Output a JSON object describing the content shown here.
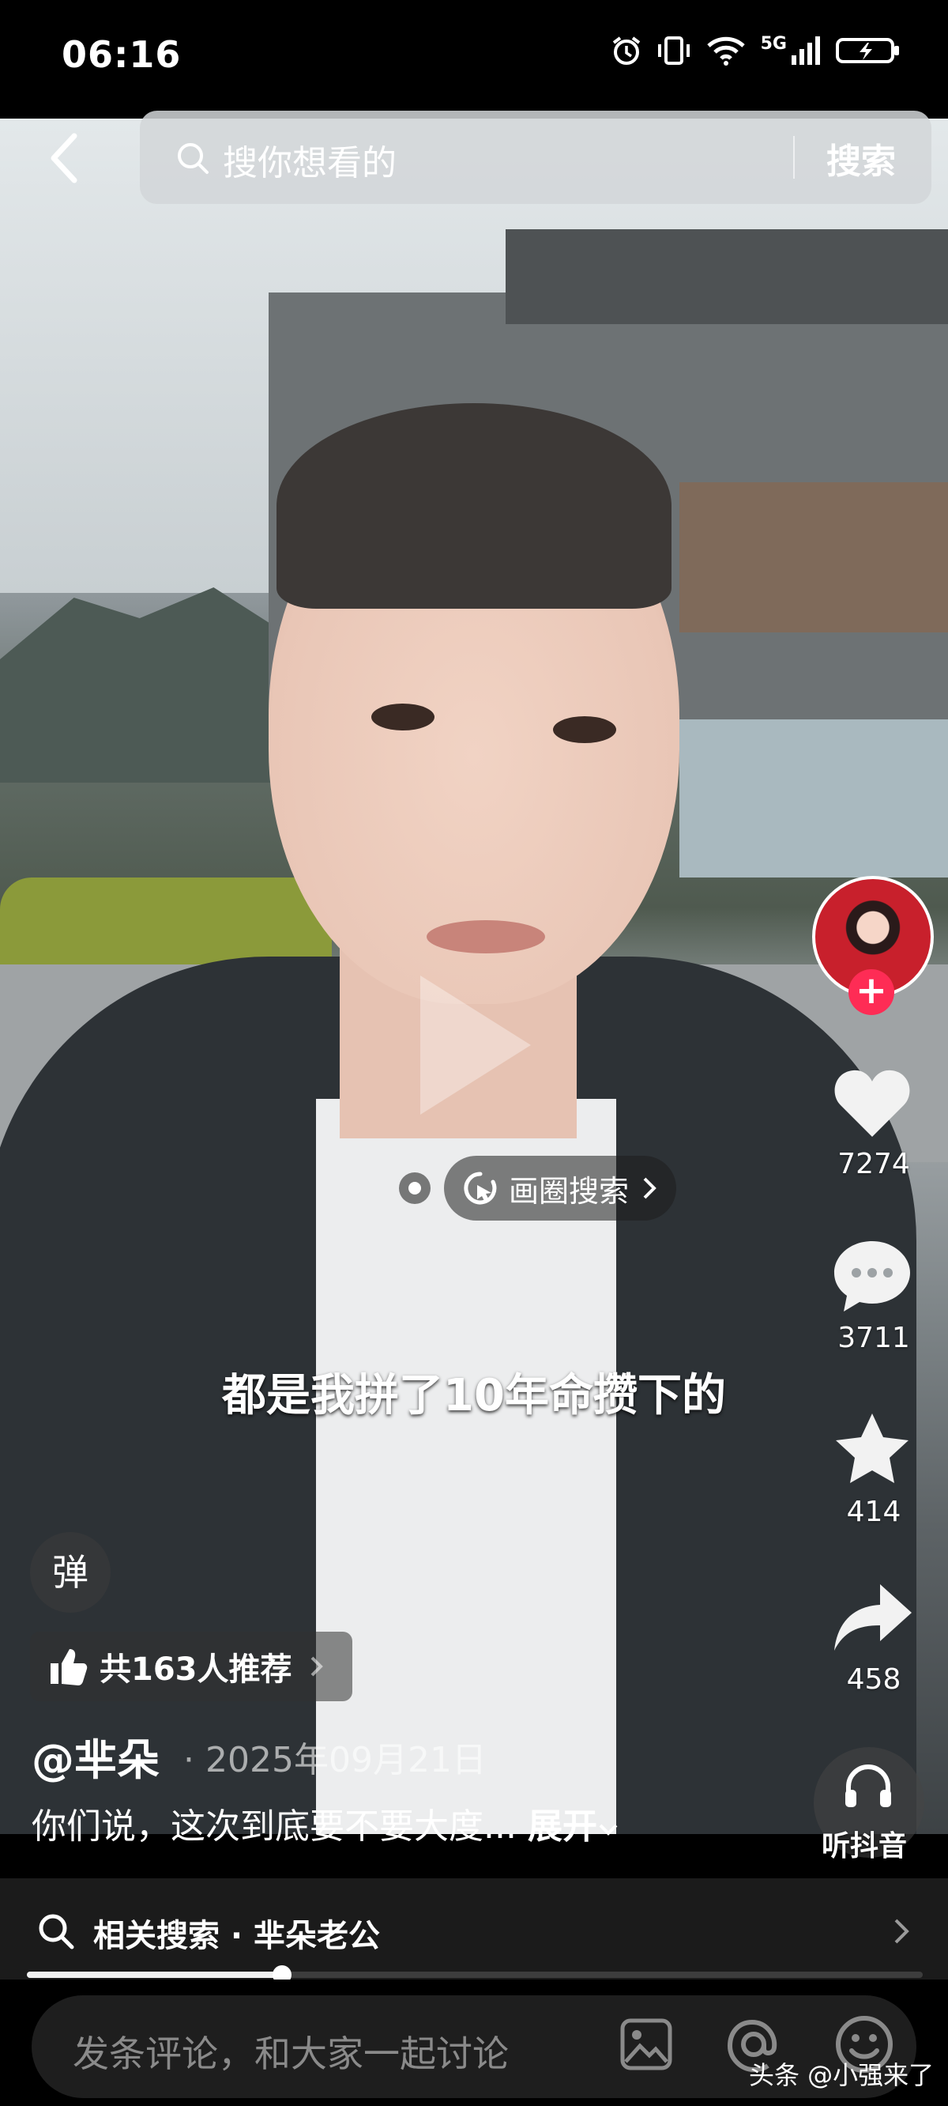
{
  "status_bar": {
    "time": "06:16",
    "network": "5G"
  },
  "search": {
    "placeholder": "搜你想看的",
    "button": "搜索"
  },
  "right_rail": {
    "likes": "7274",
    "comments": "3711",
    "favorites": "414",
    "shares": "458",
    "listen_label": "听抖音"
  },
  "video": {
    "circle_search_label": "画圈搜索",
    "subtitle": "都是我拼了10年命攒下的"
  },
  "danmu_label": "弹",
  "recommend_label": "共163人推荐",
  "post": {
    "author": "@芈朵",
    "date": "2025年09月21日",
    "caption": "你们说，这次到底要不要大度...",
    "expand_label": "展开"
  },
  "related_search": {
    "label": "相关搜索 · 芈朵老公"
  },
  "playback_progress": 0.285,
  "comment_bar": {
    "placeholder": "发条评论，和大家一起讨论"
  },
  "watermark": "头条 @小强来了",
  "colors": {
    "accent": "#fe2c55",
    "background": "#000000"
  }
}
